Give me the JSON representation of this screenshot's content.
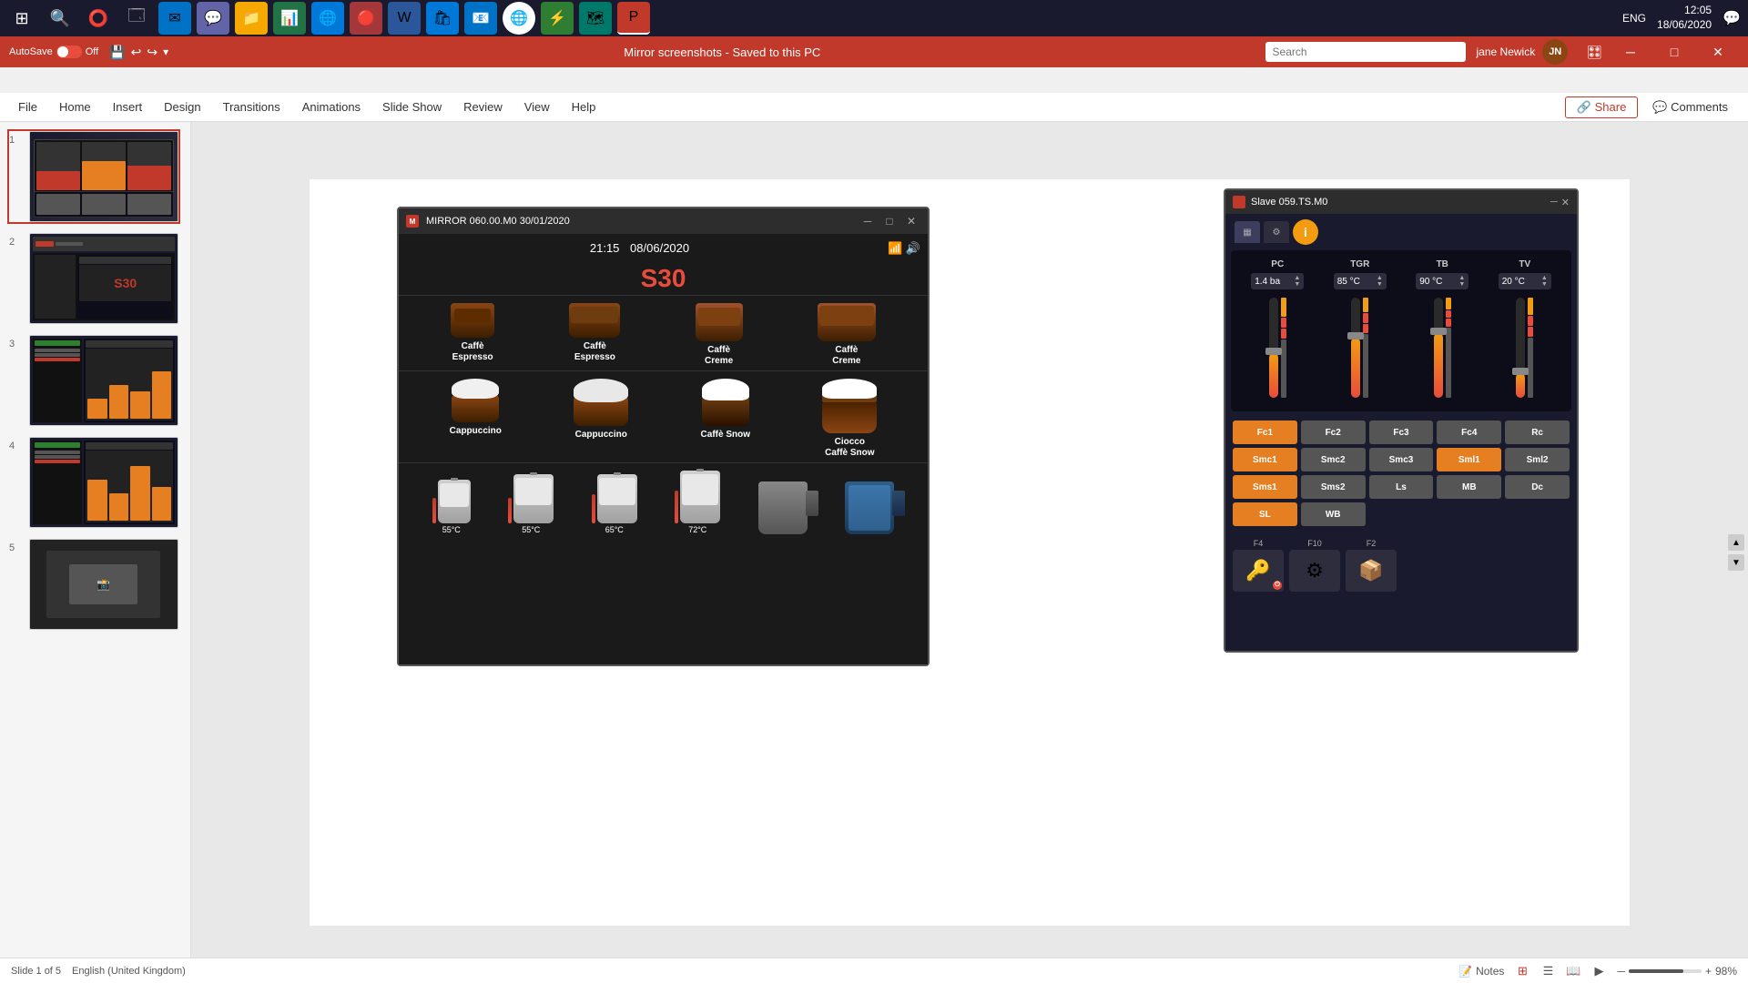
{
  "taskbar": {
    "start_icon": "⊞",
    "time": "12:05",
    "date": "18/06/2020",
    "language": "ENG",
    "apps": [
      "🔍",
      "⭕",
      "🗔",
      "✉",
      "💬",
      "📁",
      "📊",
      "🌐",
      "🔴",
      "⚡",
      "🗺",
      "🔵",
      "📊"
    ]
  },
  "ppt": {
    "titlebar": {
      "autosave_label": "AutoSave",
      "off_label": "Off",
      "title": "Mirror screenshots - Saved to this PC",
      "search_placeholder": "Search",
      "user_name": "jane Newick",
      "user_initials": "JN"
    },
    "menu": {
      "items": [
        "File",
        "Home",
        "Insert",
        "Design",
        "Transitions",
        "Animations",
        "Slide Show",
        "Review",
        "View",
        "Help"
      ],
      "share": "Share",
      "comments": "Comments"
    },
    "status": {
      "slide_info": "Slide 1 of 5",
      "language": "English (United Kingdom)",
      "notes": "Notes",
      "zoom": "98%"
    }
  },
  "slides": [
    {
      "number": "1",
      "active": true
    },
    {
      "number": "2",
      "active": false
    },
    {
      "number": "3",
      "active": false
    },
    {
      "number": "4",
      "active": false
    },
    {
      "number": "5",
      "active": false
    }
  ],
  "mirror_window": {
    "title": "MIRROR 060.00.M0 30/01/2020",
    "time": "21:15",
    "date": "08/06/2020",
    "s_value": "S30",
    "coffees_row1": [
      {
        "label": "Caffè\nEspresso",
        "icon": "☕"
      },
      {
        "label": "Caffè\nEspresso",
        "icon": "☕"
      },
      {
        "label": "Caffè\nCreme",
        "icon": "☕"
      },
      {
        "label": "Caffè\nCreme",
        "icon": "☕"
      }
    ],
    "coffees_row2": [
      {
        "label": "Cappuccino",
        "icon": "🍵"
      },
      {
        "label": "Cappuccino",
        "icon": "🍵"
      },
      {
        "label": "Caffè Snow",
        "icon": "🍵"
      },
      {
        "label": "Ciocco\nCaffè Snow",
        "icon": "🍵"
      }
    ],
    "jugs": [
      {
        "temp": "55°C",
        "has_therm": true
      },
      {
        "temp": "55°C",
        "has_therm": true
      },
      {
        "temp": "65°C",
        "has_therm": true
      },
      {
        "temp": "72°C",
        "has_therm": true
      },
      {
        "temp": "",
        "has_therm": false
      },
      {
        "temp": "",
        "has_therm": false
      }
    ]
  },
  "slave_window": {
    "title": "Slave 059.TS.M0",
    "controls": [
      {
        "label": "PC",
        "value": "1.4 ba"
      },
      {
        "label": "TGR",
        "value": "85 °C"
      },
      {
        "label": "TB",
        "value": "90 °C"
      },
      {
        "label": "TV",
        "value": "20 °C"
      }
    ],
    "buttons_row1": [
      {
        "label": "Fc1",
        "style": "orange"
      },
      {
        "label": "Fc2",
        "style": "gray"
      },
      {
        "label": "Fc3",
        "style": "gray"
      },
      {
        "label": "Fc4",
        "style": "gray"
      },
      {
        "label": "Rc",
        "style": "gray"
      }
    ],
    "buttons_row2": [
      {
        "label": "Smc1",
        "style": "orange"
      },
      {
        "label": "Smc2",
        "style": "gray"
      },
      {
        "label": "Smc3",
        "style": "gray"
      },
      {
        "label": "Sml1",
        "style": "orange"
      },
      {
        "label": "Sml2",
        "style": "gray"
      }
    ],
    "buttons_row3": [
      {
        "label": "Sms1",
        "style": "orange"
      },
      {
        "label": "Sms2",
        "style": "gray"
      },
      {
        "label": "Ls",
        "style": "gray"
      },
      {
        "label": "MB",
        "style": "gray"
      },
      {
        "label": "Dc",
        "style": "gray"
      }
    ],
    "buttons_row4": [
      {
        "label": "SL",
        "style": "orange"
      },
      {
        "label": "WB",
        "style": "gray"
      }
    ],
    "func_icons": [
      {
        "label": "F4",
        "icon": "🔑"
      },
      {
        "label": "F10",
        "icon": "⚙"
      },
      {
        "label": "F2",
        "icon": "📦"
      }
    ]
  }
}
